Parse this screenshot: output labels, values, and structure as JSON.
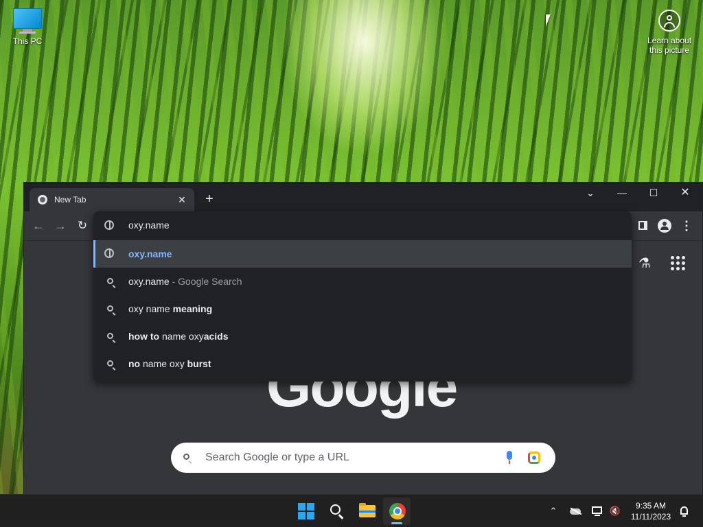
{
  "desktop": {
    "icons": [
      {
        "label": "This PC",
        "icon": "computer-icon"
      },
      {
        "label_line1": "Learn about",
        "label_line2": "this picture",
        "icon": "learn-about-picture-icon"
      }
    ]
  },
  "browser": {
    "tab": {
      "title": "New Tab",
      "favicon": "chrome-icon"
    },
    "new_tab_label": "+",
    "window_controls": {
      "tab_search": "⌄",
      "minimize": "—",
      "maximize": "☐",
      "close": "✕"
    },
    "toolbar": {
      "back": "←",
      "forward": "→",
      "reload": "↻",
      "menu": "⋮"
    },
    "omnibox": {
      "value": "oxy.name",
      "suggestions": [
        {
          "type": "url",
          "icon": "globe-icon",
          "text": "oxy.name",
          "selected": true
        },
        {
          "type": "search",
          "icon": "search-icon",
          "main": "oxy.name",
          "secondary": " - Google Search"
        },
        {
          "type": "search",
          "icon": "search-icon",
          "plain": "oxy name ",
          "bold": "meaning"
        },
        {
          "type": "search",
          "icon": "search-icon",
          "bold1": "how to",
          "plain": " name oxy",
          "bold2": "acids"
        },
        {
          "type": "search",
          "icon": "search-icon",
          "bold1": "no",
          "plain": " name oxy ",
          "bold2": "burst"
        }
      ]
    },
    "ntp": {
      "logo_text": "Google",
      "search_placeholder": "Search Google or type a URL",
      "labs_icon": "⚗"
    },
    "colors": {
      "accent": "#8ab4f8",
      "dark_bg": "#202124",
      "page_bg": "#35363a"
    }
  },
  "taskbar": {
    "apps": [
      "start-icon",
      "search-icon",
      "file-explorer-icon",
      "chrome-icon"
    ],
    "tray": {
      "chevron": "⌃",
      "volume": "🔇"
    },
    "clock": {
      "time": "9:35 AM",
      "date": "11/11/2023"
    }
  }
}
